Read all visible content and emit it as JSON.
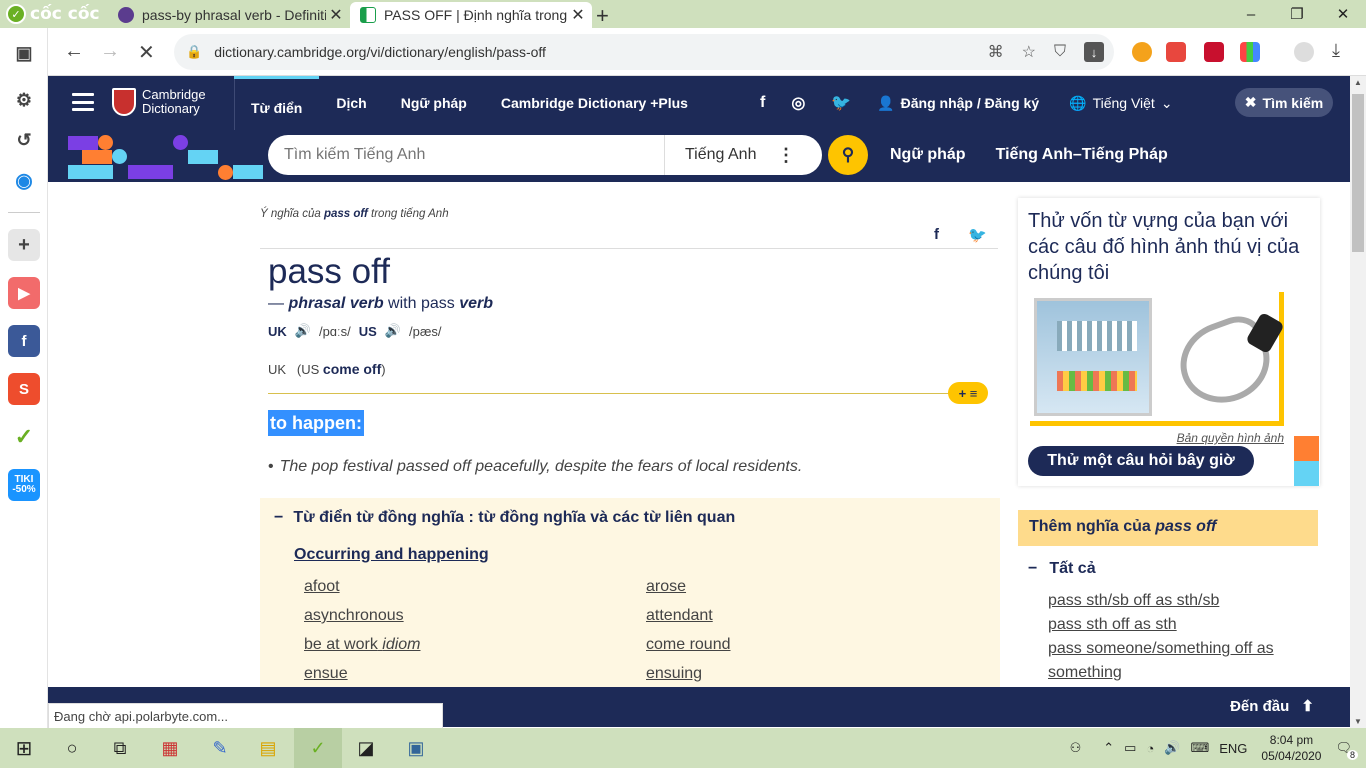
{
  "browser": {
    "brand": "cốc cốc",
    "tabs": [
      {
        "title": "pass-by phrasal verb - Definiti",
        "active": false,
        "favicon_color": "#5b3c8e"
      },
      {
        "title": "PASS OFF | Định nghĩa trong t",
        "active": true,
        "favicon_color": "#1a9e4b"
      }
    ],
    "window_controls": [
      "minimize",
      "maximize",
      "close"
    ],
    "url": "dictionary.cambridge.org/vi/dictionary/english/pass-off",
    "status_text": "Đang chờ api.polarbyte.com..."
  },
  "site": {
    "logo_line1": "Cambridge",
    "logo_line2": "Dictionary",
    "nav": [
      "Từ điển",
      "Dịch",
      "Ngữ pháp",
      "Cambridge Dictionary +Plus"
    ],
    "login": "Đăng nhập / Đăng ký",
    "language": "Tiếng Việt",
    "search_toggle": "Tìm kiếm",
    "search_placeholder": "Tìm kiếm Tiếng Anh",
    "search_dict": "Tiếng Anh",
    "band_links": [
      "Ngữ pháp",
      "Tiếng Anh–Tiếng Pháp"
    ]
  },
  "entry": {
    "crumb_pre": "Ý nghĩa của ",
    "crumb_word": "pass off",
    "crumb_post": " trong tiếng Anh",
    "headword": "pass off",
    "pos_dash": "— ",
    "pos": "phrasal verb",
    "pos_with": " with pass ",
    "pos_verb": "verb",
    "uk_label": "UK",
    "uk_ipa": "/pɑːs/",
    "us_label": "US",
    "us_ipa": "/pæs/",
    "region_uk": "UK",
    "region_paren_open": "(US ",
    "region_us_word": "come off",
    "region_paren_close": ")",
    "definition": "to happen:",
    "example": "The pop festival passed off peacefully, despite the fears of local residents.",
    "plus_label": "+ ≡"
  },
  "thesaurus": {
    "heading": "Từ điển từ đồng nghĩa : từ đồng nghĩa và các từ liên quan",
    "category": "Occurring and happening",
    "left": [
      "afoot",
      "asynchronous",
      "be at work",
      "ensue"
    ],
    "left_idiom": "idiom",
    "right": [
      "arose",
      "attendant",
      "come round",
      "ensuing"
    ]
  },
  "rail": {
    "quiz_title": "Thử vốn từ vựng của bạn với các câu đố hình ảnh thú vị của chúng tôi",
    "copyright": "Bản quyền hình ảnh",
    "quiz_button": "Thử một câu hỏi bây giờ",
    "more_pre": "Thêm nghĩa của ",
    "more_word": "pass off",
    "all_label": "Tất cả",
    "more_items": [
      "pass sth/sb off as sth/sb",
      "pass sth off as sth",
      "pass someone/something off as",
      "something"
    ]
  },
  "footer": {
    "to_top": "Đến đầu"
  },
  "taskbar": {
    "lang": "ENG",
    "time": "8:04 pm",
    "date": "05/04/2020",
    "notifications": "8"
  },
  "colors": {
    "navy": "#1d2a57",
    "yellow": "#fec400",
    "highlight": "#3390ff",
    "thesaurus_bg": "#fef7e2",
    "taskbar": "#cfe0bd"
  },
  "icons": [
    "coccoc-logo",
    "back-icon",
    "forward-icon",
    "stop-icon",
    "lock-icon",
    "translate-icon",
    "star-icon",
    "shield-icon",
    "download-icon",
    "hamburger-icon",
    "facebook-icon",
    "instagram-icon",
    "twitter-icon",
    "user-icon",
    "globe-icon",
    "close-icon",
    "search-icon",
    "speaker-icon",
    "arrow-up-icon",
    "windows-icon"
  ]
}
